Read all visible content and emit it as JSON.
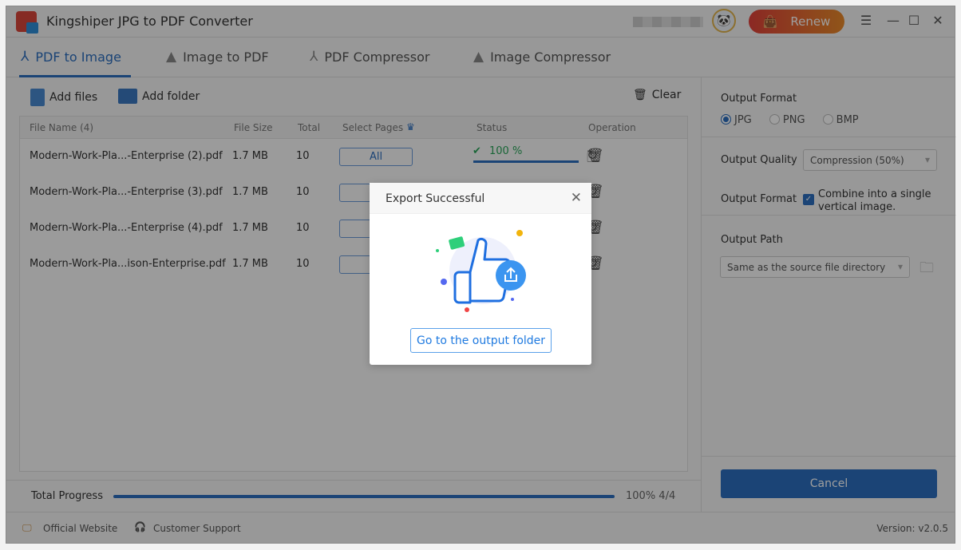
{
  "app": {
    "title": "Kingshiper JPG to PDF Converter",
    "renew_label": "Renew"
  },
  "tabs": [
    {
      "label": "PDF to Image",
      "active": true
    },
    {
      "label": "Image to PDF"
    },
    {
      "label": "PDF Compressor"
    },
    {
      "label": "Image Compressor"
    }
  ],
  "toolbar": {
    "add_files": "Add files",
    "add_folder": "Add folder",
    "clear": "Clear"
  },
  "table": {
    "headers": [
      "File Name (4)",
      "File Size",
      "Total",
      "Select Pages",
      "Status",
      "Operation"
    ],
    "rows": [
      {
        "name": "Modern-Work-Pla...-Enterprise (2).pdf",
        "size": "1.7 MB",
        "total": "10",
        "pages": "All",
        "status": "100 %",
        "progress": 100
      },
      {
        "name": "Modern-Work-Pla...-Enterprise (3).pdf",
        "size": "1.7 MB",
        "total": "10"
      },
      {
        "name": "Modern-Work-Pla...-Enterprise (4).pdf",
        "size": "1.7 MB",
        "total": "10"
      },
      {
        "name": "Modern-Work-Pla...ison-Enterprise.pdf",
        "size": "1.7 MB",
        "total": "10"
      }
    ]
  },
  "progress": {
    "label": "Total Progress",
    "value": "100% 4/4",
    "percent": 100
  },
  "settings": {
    "output_format_label": "Output Format",
    "formats": [
      "JPG",
      "PNG",
      "BMP"
    ],
    "selected_format": "JPG",
    "quality_label": "Output Quality",
    "quality_value": "Compression (50%)",
    "combine_label": "Output Format",
    "combine_text": "Combine into a single vertical image.",
    "combine_checked": true,
    "path_label": "Output Path",
    "path_value": "Same as the source file directory",
    "cancel": "Cancel"
  },
  "footer": {
    "website": "Official Website",
    "support": "Customer Support",
    "version": "Version: v2.0.5"
  },
  "dialog": {
    "title": "Export Successful",
    "button": "Go to the output folder"
  },
  "colors": {
    "accent": "#2d6fbf",
    "success": "#2aa55a",
    "renew_start": "#e0413a",
    "renew_end": "#e88a2a"
  }
}
